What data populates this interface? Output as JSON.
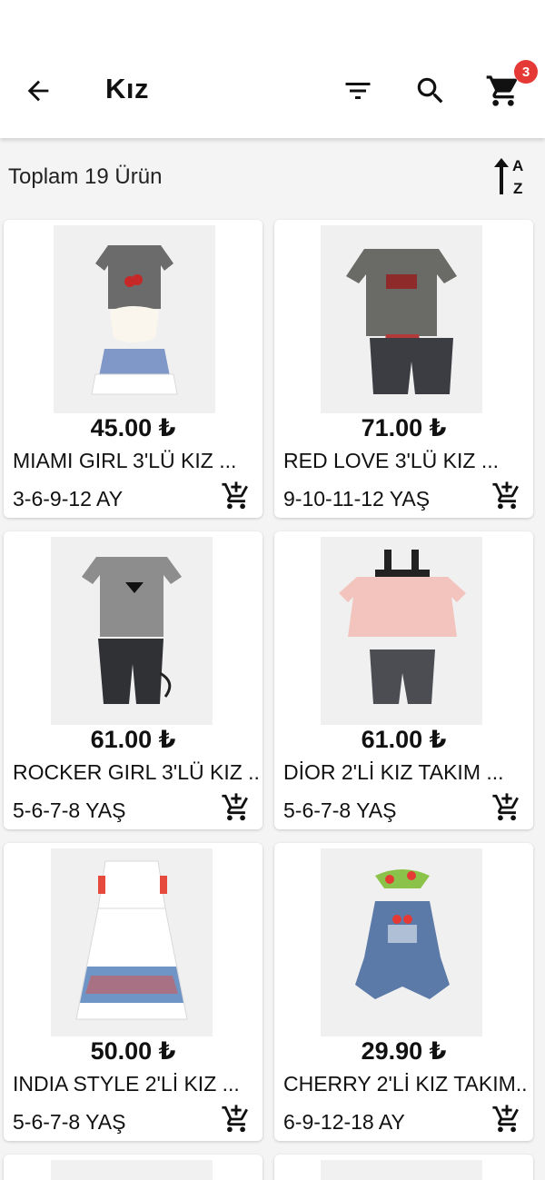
{
  "appbar": {
    "title": "Kız",
    "cart_count": "3"
  },
  "summary": {
    "count_text": "Toplam 19 Ürün"
  },
  "products": [
    {
      "price": "45.00 ₺",
      "name": "MIAMI GIRL 3'LÜ KIZ ...",
      "size": "3-6-9-12 AY"
    },
    {
      "price": "71.00 ₺",
      "name": "RED LOVE 3'LÜ KIZ ...",
      "size": "9-10-11-12 YAŞ"
    },
    {
      "price": "61.00 ₺",
      "name": "ROCKER GIRL 3'LÜ KIZ ...",
      "size": "5-6-7-8 YAŞ"
    },
    {
      "price": "61.00 ₺",
      "name": "DİOR 2'Lİ KIZ TAKIM ...",
      "size": "5-6-7-8 YAŞ"
    },
    {
      "price": "50.00 ₺",
      "name": "INDIA STYLE 2'Lİ KIZ ...",
      "size": "5-6-7-8 YAŞ"
    },
    {
      "price": "29.90 ₺",
      "name": "CHERRY 2'Lİ KIZ TAKIM...",
      "size": "6-9-12-18 AY"
    }
  ],
  "colors": {
    "badge": "#e53935",
    "icon": "#111111"
  },
  "icons": {
    "back": "arrow-left-icon",
    "filter": "filter-icon",
    "search": "search-icon",
    "cart": "cart-icon",
    "sort": "sort-alpha-icon",
    "add_to_cart": "add-to-cart-icon"
  }
}
